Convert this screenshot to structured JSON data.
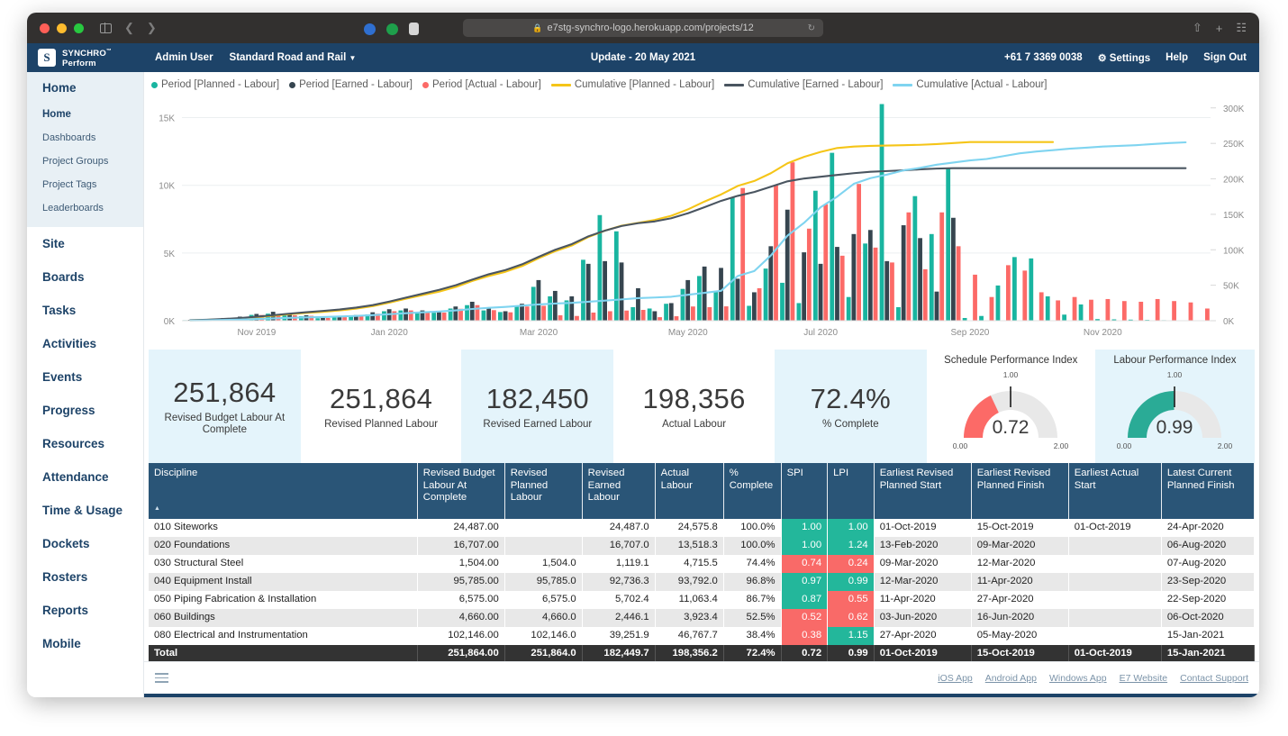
{
  "browser": {
    "url": "e7stg-synchro-logo.herokuapp.com/projects/12",
    "lock_icon": "lock-icon",
    "reload_icon": "reload-icon",
    "back_icon": "back-arrow-icon",
    "forward_icon": "forward-arrow-icon",
    "sidebar_icon": "sidebar-toggle-icon",
    "share_icon": "share-icon",
    "newtab_icon": "new-tab-icon",
    "tabs_icon": "show-tabs-icon"
  },
  "header": {
    "brand_line1": "SYNCHRO",
    "brand_tm": "™",
    "brand_line2": "Perform",
    "logo_glyph": "S",
    "user": "Admin User",
    "project": "Standard Road and Rail",
    "project_caret": "▼",
    "update": "Update - 20 May 2021",
    "phone": "+61 7 3369 0038",
    "settings": "Settings",
    "settings_icon": "gear-icon",
    "help": "Help",
    "signout": "Sign Out"
  },
  "sidebar": {
    "active": "Home",
    "sub_items": [
      "Home",
      "Dashboards",
      "Project Groups",
      "Project Tags",
      "Leaderboards"
    ],
    "main_items": [
      "Site",
      "Boards",
      "Tasks",
      "Activities",
      "Events",
      "Progress",
      "Resources",
      "Attendance",
      "Time & Usage",
      "Dockets",
      "Rosters",
      "Reports",
      "Mobile"
    ]
  },
  "chart_data": {
    "type": "bar",
    "title": "",
    "xlabel": "",
    "ylabel": "",
    "y_left_ticks": [
      "0K",
      "5K",
      "10K",
      "15K"
    ],
    "y_left_values": [
      0,
      5000,
      10000,
      15000
    ],
    "ylim": [
      0,
      16500
    ],
    "y_right_ticks": [
      "0K",
      "50K",
      "100K",
      "150K",
      "200K",
      "250K",
      "300K"
    ],
    "y_right_values": [
      0,
      50000,
      100000,
      150000,
      200000,
      250000,
      300000
    ],
    "y_right_lim": [
      0,
      315000
    ],
    "grid": true,
    "legend_position": "top",
    "x_tick_labels": [
      "Nov 2019",
      "Jan 2020",
      "Mar 2020",
      "May 2020",
      "Jul 2020",
      "Sep 2020",
      "Nov 2020"
    ],
    "x_tick_index": [
      4,
      12,
      21,
      30,
      38,
      47,
      55
    ],
    "legend": [
      {
        "label": "Period [Planned - Labour]",
        "color": "#19b5a0",
        "marker": "dot"
      },
      {
        "label": "Period [Earned - Labour]",
        "color": "#36454f",
        "marker": "dot"
      },
      {
        "label": "Period [Actual - Labour]",
        "color": "#fc6a67",
        "marker": "dot"
      },
      {
        "label": "Cumulative [Planned - Labour]",
        "color": "#f5c518",
        "marker": "line"
      },
      {
        "label": "Cumulative [Earned - Labour]",
        "color": "#4a5560",
        "marker": "line"
      },
      {
        "label": "Cumulative [Actual - Labour]",
        "color": "#7fd4f0",
        "marker": "line"
      }
    ],
    "series": [
      {
        "name": "Period [Planned - Labour]",
        "type": "bar",
        "color": "#19b5a0",
        "axis": "left",
        "values": [
          40,
          60,
          120,
          160,
          430,
          520,
          390,
          330,
          180,
          250,
          310,
          470,
          700,
          760,
          620,
          590,
          900,
          1150,
          760,
          640,
          1060,
          2500,
          1800,
          1500,
          4500,
          7800,
          6600,
          1000,
          900,
          1250,
          2350,
          3300,
          2150,
          9100,
          1100,
          3850,
          2800,
          1300,
          9600,
          12400,
          1750,
          5700,
          16000,
          1000,
          9200,
          6400,
          11300,
          200,
          350,
          2600,
          4700,
          4600,
          1800,
          450,
          1200,
          120,
          100,
          80,
          60,
          40,
          0,
          0
        ]
      },
      {
        "name": "Period [Earned - Labour]",
        "type": "bar",
        "color": "#36454f",
        "axis": "left",
        "values": [
          60,
          80,
          200,
          300,
          500,
          660,
          520,
          400,
          220,
          300,
          420,
          620,
          850,
          900,
          760,
          700,
          1050,
          1400,
          900,
          700,
          1250,
          3000,
          2200,
          1800,
          4200,
          4400,
          4300,
          2400,
          700,
          1300,
          3000,
          4000,
          3900,
          3100,
          2100,
          5500,
          8200,
          5050,
          4200,
          5450,
          6400,
          6700,
          4400,
          7050,
          6100,
          2150,
          7600,
          0,
          0,
          0,
          0,
          0,
          0,
          0,
          0,
          0,
          0,
          0,
          0,
          0,
          0,
          0
        ]
      },
      {
        "name": "Period [Actual - Labour]",
        "type": "bar",
        "color": "#fc6a67",
        "axis": "left",
        "values": [
          50,
          70,
          180,
          260,
          420,
          480,
          400,
          360,
          200,
          260,
          360,
          520,
          700,
          760,
          640,
          600,
          880,
          1150,
          780,
          620,
          1050,
          1100,
          400,
          350,
          600,
          700,
          750,
          800,
          260,
          330,
          1050,
          1000,
          1060,
          9800,
          2400,
          10000,
          11700,
          6800,
          8600,
          4800,
          10100,
          5400,
          4300,
          8000,
          3800,
          8000,
          5500,
          3400,
          1750,
          4100,
          3700,
          2100,
          1500,
          1750,
          1550,
          1600,
          1450,
          1400,
          1600,
          1450,
          1350,
          900
        ]
      },
      {
        "name": "Cumulative [Planned - Labour]",
        "type": "line",
        "color": "#f5c518",
        "axis": "right",
        "values": [
          600,
          1200,
          2000,
          3200,
          5000,
          7000,
          9200,
          11000,
          12500,
          14500,
          17000,
          20500,
          25500,
          31000,
          36000,
          41000,
          47500,
          56000,
          63000,
          69000,
          77000,
          88000,
          98000,
          106000,
          118000,
          127000,
          134000,
          138000,
          142000,
          148000,
          157000,
          168000,
          178000,
          190000,
          197000,
          208000,
          222000,
          231000,
          238000,
          243500,
          245500,
          246500,
          247000,
          247500,
          248000,
          249000,
          250500,
          251864,
          251864,
          251864,
          251864,
          251864,
          251864,
          null,
          null,
          null,
          null,
          null,
          null,
          null,
          null,
          null
        ]
      },
      {
        "name": "Cumulative [Earned - Labour]",
        "type": "line",
        "color": "#4a5560",
        "axis": "right",
        "values": [
          700,
          1400,
          2400,
          3800,
          5600,
          7800,
          10000,
          12000,
          13800,
          15800,
          18500,
          22000,
          27000,
          32500,
          38000,
          43500,
          50000,
          58000,
          65500,
          71500,
          79500,
          90000,
          100000,
          108000,
          119000,
          127000,
          133500,
          137500,
          140000,
          144500,
          151500,
          160000,
          169000,
          176000,
          181500,
          189000,
          196500,
          200500,
          203000,
          205500,
          208000,
          210000,
          211000,
          212000,
          213500,
          214500,
          215000,
          215000,
          215000,
          215000,
          215000,
          215000,
          215000,
          215000,
          215000,
          215000,
          215000,
          215000,
          215000,
          215000,
          215000
        ]
      },
      {
        "name": "Cumulative [Actual - Labour]",
        "type": "line",
        "color": "#7fd4f0",
        "axis": "right",
        "values": [
          300,
          600,
          1000,
          1600,
          2400,
          3200,
          4000,
          4700,
          5200,
          5900,
          6700,
          7800,
          9200,
          10600,
          11800,
          13000,
          14500,
          16500,
          18200,
          19500,
          21200,
          23000,
          24200,
          25200,
          26800,
          28400,
          30000,
          31800,
          32700,
          33800,
          36600,
          39300,
          42200,
          63000,
          70000,
          92000,
          120000,
          138000,
          160000,
          175000,
          193000,
          201000,
          206000,
          212000,
          215500,
          220000,
          223000,
          226000,
          228000,
          232000,
          236000,
          238500,
          240500,
          242500,
          244000,
          245500,
          246500,
          247500,
          249000,
          250500,
          251500
        ]
      }
    ]
  },
  "kpis": [
    {
      "value": "251,864",
      "caption": "Revised Budget Labour At Complete",
      "tint": true
    },
    {
      "value": "251,864",
      "caption": "Revised Planned Labour",
      "tint": false
    },
    {
      "value": "182,450",
      "caption": "Revised Earned Labour",
      "tint": true
    },
    {
      "value": "198,356",
      "caption": "Actual Labour",
      "tint": false
    },
    {
      "value": "72.4%",
      "caption": "% Complete",
      "tint": true
    }
  ],
  "gauges": [
    {
      "title": "Schedule Performance Index",
      "value": "0.72",
      "value_num": 0.72,
      "min": "0.00",
      "max": "2.00",
      "target": "1.00",
      "color": "#fc6a67",
      "tint": false
    },
    {
      "title": "Labour Performance Index",
      "value": "0.99",
      "value_num": 0.99,
      "min": "0.00",
      "max": "2.00",
      "target": "1.00",
      "color": "#2aab96",
      "tint": true
    }
  ],
  "table": {
    "sort_icon": "sort-ascending-icon",
    "columns": [
      "Discipline",
      "Revised Budget Labour At Complete",
      "Revised Planned Labour",
      "Revised Earned Labour",
      "Actual Labour",
      "% Complete",
      "SPI",
      "LPI",
      "Earliest Revised Planned Start",
      "Earliest Revised Planned Finish",
      "Earliest Actual Start",
      "Latest Current Planned Finish"
    ],
    "rows": [
      {
        "discipline": "010 Siteworks",
        "budget": "24,487.00",
        "planned": "",
        "earned": "24,487.0",
        "actual": "24,575.8",
        "complete": "100.0%",
        "spi": "1.00",
        "spi_state": "good",
        "lpi": "1.00",
        "lpi_state": "good",
        "start": "01-Oct-2019",
        "finish": "15-Oct-2019",
        "actual_start": "01-Oct-2019",
        "latest_finish": "24-Apr-2020"
      },
      {
        "discipline": "020 Foundations",
        "budget": "16,707.00",
        "planned": "",
        "earned": "16,707.0",
        "actual": "13,518.3",
        "complete": "100.0%",
        "spi": "1.00",
        "spi_state": "good",
        "lpi": "1.24",
        "lpi_state": "good",
        "start": "13-Feb-2020",
        "finish": "09-Mar-2020",
        "actual_start": "",
        "latest_finish": "06-Aug-2020"
      },
      {
        "discipline": "030 Structural Steel",
        "budget": "1,504.00",
        "planned": "1,504.0",
        "earned": "1,119.1",
        "actual": "4,715.5",
        "complete": "74.4%",
        "spi": "0.74",
        "spi_state": "bad",
        "lpi": "0.24",
        "lpi_state": "bad",
        "start": "09-Mar-2020",
        "finish": "12-Mar-2020",
        "actual_start": "",
        "latest_finish": "07-Aug-2020"
      },
      {
        "discipline": "040 Equipment Install",
        "budget": "95,785.00",
        "planned": "95,785.0",
        "earned": "92,736.3",
        "actual": "93,792.0",
        "complete": "96.8%",
        "spi": "0.97",
        "spi_state": "good",
        "lpi": "0.99",
        "lpi_state": "good",
        "start": "12-Mar-2020",
        "finish": "11-Apr-2020",
        "actual_start": "",
        "latest_finish": "23-Sep-2020"
      },
      {
        "discipline": "050 Piping Fabrication & Installation",
        "budget": "6,575.00",
        "planned": "6,575.0",
        "earned": "5,702.4",
        "actual": "11,063.4",
        "complete": "86.7%",
        "spi": "0.87",
        "spi_state": "good",
        "lpi": "0.55",
        "lpi_state": "bad",
        "start": "11-Apr-2020",
        "finish": "27-Apr-2020",
        "actual_start": "",
        "latest_finish": "22-Sep-2020"
      },
      {
        "discipline": "060 Buildings",
        "budget": "4,660.00",
        "planned": "4,660.0",
        "earned": "2,446.1",
        "actual": "3,923.4",
        "complete": "52.5%",
        "spi": "0.52",
        "spi_state": "bad",
        "lpi": "0.62",
        "lpi_state": "bad",
        "start": "03-Jun-2020",
        "finish": "16-Jun-2020",
        "actual_start": "",
        "latest_finish": "06-Oct-2020"
      },
      {
        "discipline": "080 Electrical and Instrumentation",
        "budget": "102,146.00",
        "planned": "102,146.0",
        "earned": "39,251.9",
        "actual": "46,767.7",
        "complete": "38.4%",
        "spi": "0.38",
        "spi_state": "bad",
        "lpi": "1.15",
        "lpi_state": "good",
        "start": "27-Apr-2020",
        "finish": "05-May-2020",
        "actual_start": "",
        "latest_finish": "15-Jan-2021"
      }
    ],
    "total": {
      "discipline": "Total",
      "budget": "251,864.00",
      "planned": "251,864.0",
      "earned": "182,449.7",
      "actual": "198,356.2",
      "complete": "72.4%",
      "spi": "0.72",
      "lpi": "0.99",
      "start": "01-Oct-2019",
      "finish": "15-Oct-2019",
      "actual_start": "01-Oct-2019",
      "latest_finish": "15-Jan-2021"
    }
  },
  "footer": {
    "menu_icon": "hamburger-menu-icon",
    "links": [
      "iOS App",
      "Android App",
      "Windows App",
      "E7 Website",
      "Contact Support"
    ]
  },
  "colors": {
    "brand_blue": "#1d4368",
    "teal": "#19b5a0",
    "dark": "#36454f",
    "red": "#fc6a67",
    "yellow": "#f5c518",
    "lightblue": "#7fd4f0",
    "good": "#23b79b",
    "bad": "#f96a68"
  }
}
